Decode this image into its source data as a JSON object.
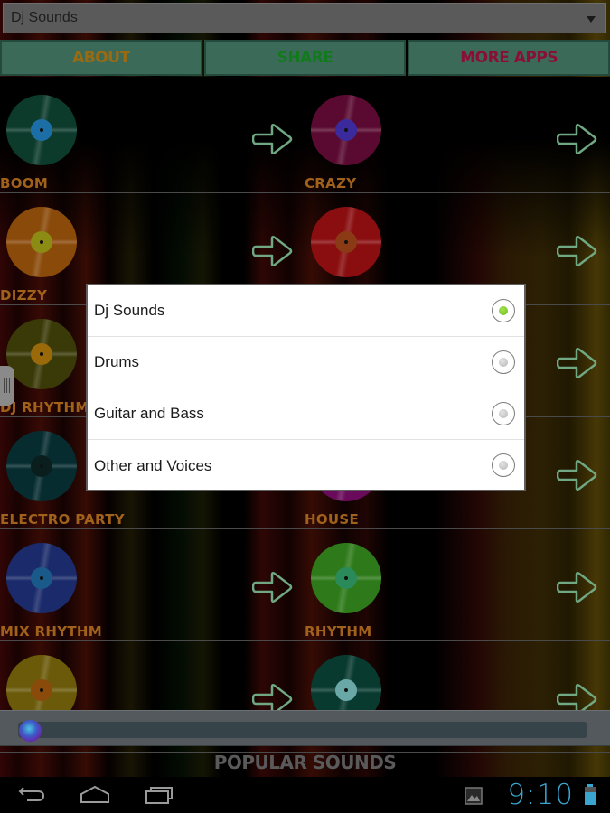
{
  "spinner": {
    "selected": "Dj Sounds"
  },
  "top_buttons": [
    {
      "label": "ABOUT",
      "color": "#9a6a12"
    },
    {
      "label": "SHARE",
      "color": "#127a1c"
    },
    {
      "label": "MORE APPS",
      "color": "#8a0f38"
    }
  ],
  "sounds": [
    {
      "name": "BOOM",
      "disc_color": "#0c3b2c",
      "center_color": "#1c6fa6"
    },
    {
      "name": "CRAZY",
      "disc_color": "#5a0a30",
      "center_color": "#3a2a9c"
    },
    {
      "name": "DIZZY",
      "disc_color": "#8a4a0a",
      "center_color": "#8c8c14"
    },
    {
      "name": "",
      "disc_color": "#8a0e10",
      "center_color": "#8a3a14"
    },
    {
      "name": "DJ RHYTHM",
      "disc_color": "#3a3a08",
      "center_color": "#9a6a0a"
    },
    {
      "name": "",
      "disc_color": "#222222",
      "center_color": "#333333"
    },
    {
      "name": "ELECTRO PARTY",
      "disc_color": "#062c30",
      "center_color": "#0a1e1e"
    },
    {
      "name": "HOUSE",
      "disc_color": "#6a0a5a",
      "center_color": "#8a1a7a"
    },
    {
      "name": "MIX RHYTHM",
      "disc_color": "#1a2a6a",
      "center_color": "#1a5a8a"
    },
    {
      "name": "RHYTHM",
      "disc_color": "#2e7a1a",
      "center_color": "#2a8a5a"
    },
    {
      "name": "",
      "disc_color": "#6a5a0a",
      "center_color": "#8a4a0a"
    },
    {
      "name": "",
      "disc_color": "#083a30",
      "center_color": "#6aa8a8"
    }
  ],
  "player": {
    "progress": 0
  },
  "popular_label": "POPULAR SOUNDS",
  "dialog": {
    "options": [
      {
        "label": "Dj Sounds",
        "checked": true
      },
      {
        "label": "Drums",
        "checked": false
      },
      {
        "label": "Guitar and Bass",
        "checked": false
      },
      {
        "label": "Other and Voices",
        "checked": false
      }
    ]
  },
  "status": {
    "time": "9:10"
  },
  "icons": {
    "back": "back-icon",
    "home": "home-icon",
    "recents": "recent-apps-icon",
    "gallery": "image-notification-icon",
    "battery": "battery-icon"
  }
}
